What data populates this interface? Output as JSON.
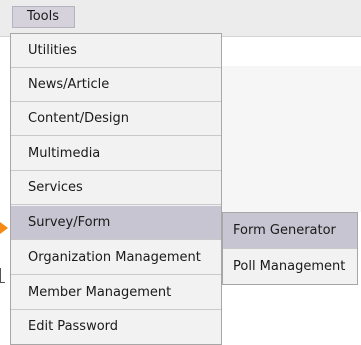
{
  "menubar": {
    "tools_label": "Tools"
  },
  "menu": {
    "items": [
      {
        "label": "Utilities"
      },
      {
        "label": "News/Article"
      },
      {
        "label": "Content/Design"
      },
      {
        "label": "Multimedia"
      },
      {
        "label": "Services"
      },
      {
        "label": "Survey/Form"
      },
      {
        "label": "Organization Management"
      },
      {
        "label": "Member Management"
      },
      {
        "label": "Edit Password"
      }
    ]
  },
  "submenu": {
    "items": [
      {
        "label": "Form Generator"
      },
      {
        "label": "Poll Management"
      }
    ]
  },
  "colors": {
    "highlight": "#c8c5d2",
    "pointer_arrow": "#f28a14"
  }
}
